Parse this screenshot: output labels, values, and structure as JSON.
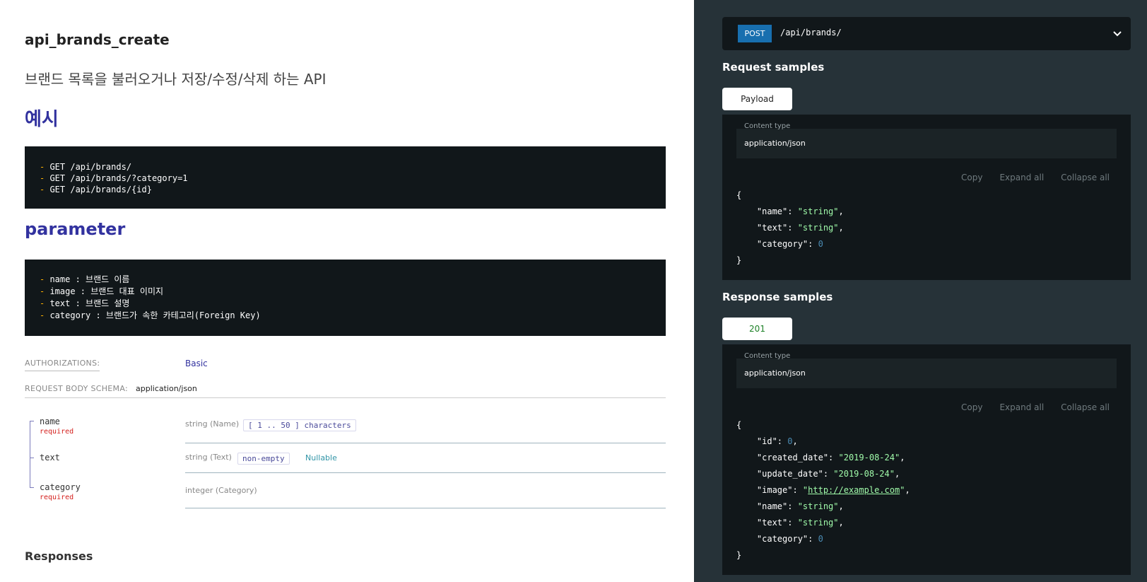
{
  "operation": {
    "title": "api_brands_create",
    "description": "브랜드 목록을 불러오거나 저장/수정/삭제 하는 API",
    "example_heading": "예시",
    "example_lines": [
      {
        "dash": "-",
        "text": " GET /api/brands/"
      },
      {
        "dash": "-",
        "text": " GET /api/brands/?category=1"
      },
      {
        "dash": "-",
        "text": " GET /api/brands/{id}"
      }
    ],
    "parameter_heading": "parameter",
    "parameter_lines": [
      {
        "dash": "-",
        "text": " name : 브랜드 이름"
      },
      {
        "dash": "-",
        "text": " image : 브랜드 대표 이미지"
      },
      {
        "dash": "-",
        "text": " text : 브랜드 설명"
      },
      {
        "dash": "-",
        "text": " category : 브랜드가 속한 카테고리(Foreign Key)"
      }
    ]
  },
  "auth": {
    "label": "AUTHORIZATIONS:",
    "value": "Basic"
  },
  "schema": {
    "label": "REQUEST BODY SCHEMA:",
    "value": "application/json"
  },
  "params": [
    {
      "name": "name",
      "required": "required",
      "type": "string (Name)",
      "constraint": "[ 1 .. 50 ] characters",
      "nullable": ""
    },
    {
      "name": "text",
      "required": "",
      "type": "string (Text)",
      "constraint": "non-empty",
      "nullable": "Nullable"
    },
    {
      "name": "category",
      "required": "required",
      "type": "integer (Category)",
      "constraint": "",
      "nullable": ""
    }
  ],
  "responses_heading": "Responses",
  "endpoint": {
    "method": "POST",
    "path": "/api/brands/",
    "chevron_icon": "chevron-down-icon"
  },
  "request_samples": {
    "title": "Request samples",
    "tab": "Payload",
    "content_type_label": "Content type",
    "content_type": "application/json",
    "tools": [
      "Copy",
      "Expand all",
      "Collapse all"
    ],
    "json_lines": [
      "{",
      "\"name\": \"string\",",
      "\"text\": \"string\",",
      "\"category\": 0",
      "}"
    ]
  },
  "response_samples": {
    "title": "Response samples",
    "tab": "201",
    "content_type_label": "Content type",
    "content_type": "application/json",
    "tools": [
      "Copy",
      "Expand all",
      "Collapse all"
    ],
    "json_lines": [
      "{",
      "\"id\": 0,",
      "\"created_date\": \"2019-08-24\",",
      "\"update_date\": \"2019-08-24\",",
      "\"image\": \"http://example.com\",",
      "\"name\": \"string\",",
      "\"text\": \"string\",",
      "\"category\": 0",
      "}"
    ]
  },
  "colors": {
    "accent": "#32329f",
    "post": "#186faf",
    "required": "#d41f1c",
    "json_string": "#a0fbaa"
  }
}
